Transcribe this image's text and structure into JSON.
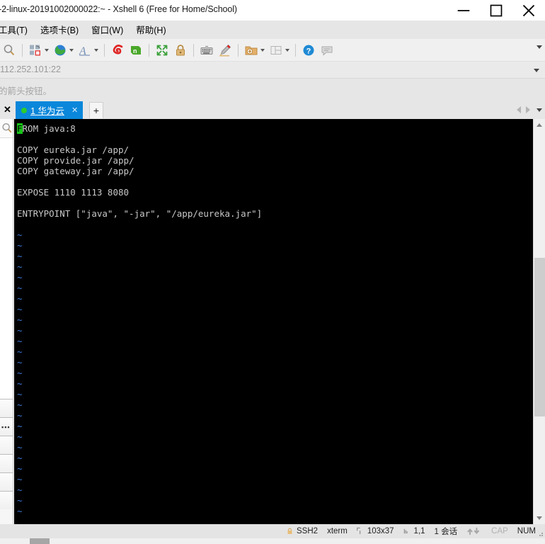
{
  "window": {
    "title": "-2-linux-20191002000022:~ - Xshell 6 (Free for Home/School)",
    "minimize_label": "minimize",
    "maximize_label": "maximize",
    "close_label": "close"
  },
  "menu": {
    "items": [
      {
        "label": "工具(T)",
        "name": "menu-tools"
      },
      {
        "label": "选项卡(B)",
        "name": "menu-tabs"
      },
      {
        "label": "窗口(W)",
        "name": "menu-window"
      },
      {
        "label": "帮助(H)",
        "name": "menu-help"
      }
    ]
  },
  "toolbar": {
    "buttons": [
      {
        "name": "find-icon",
        "icon": "magnifier"
      },
      {
        "name": "session-manager-icon",
        "icon": "session",
        "caret": true
      },
      {
        "name": "globe-icon",
        "icon": "globe",
        "caret": true
      },
      {
        "name": "font-icon",
        "icon": "font-a",
        "caret": true
      },
      {
        "name": "xftp-icon",
        "icon": "xftp-spiral"
      },
      {
        "name": "xagent-icon",
        "icon": "green-n"
      },
      {
        "name": "fullscreen-icon",
        "icon": "expand"
      },
      {
        "name": "lock-icon",
        "icon": "padlock"
      },
      {
        "name": "keyboard-icon",
        "icon": "keyboard"
      },
      {
        "name": "highlight-icon",
        "icon": "pencil"
      },
      {
        "name": "new-folder-icon",
        "icon": "folder-plus",
        "caret": true
      },
      {
        "name": "layout-icon",
        "icon": "layout",
        "caret": true
      },
      {
        "name": "help-icon",
        "icon": "question-circle"
      },
      {
        "name": "chat-icon",
        "icon": "speech-bubble"
      }
    ],
    "overflow_label": "more"
  },
  "address": {
    "value": "112.252.101:22",
    "placeholder": "112.252.101:22"
  },
  "hint": {
    "text": "的箭头按钮。"
  },
  "tabs": {
    "close_all_label": "✕",
    "items": [
      {
        "label": "1 华为云",
        "close": "✕",
        "active": true
      }
    ],
    "new_tab_label": "+",
    "nav_prev_label": "prev",
    "nav_next_label": "next"
  },
  "terminal": {
    "lines": [
      {
        "text": "FROM java:8",
        "cursor_at": 0
      },
      {
        "text": ""
      },
      {
        "text": "COPY eureka.jar /app/"
      },
      {
        "text": "COPY provide.jar /app/"
      },
      {
        "text": "COPY gateway.jar /app/"
      },
      {
        "text": ""
      },
      {
        "text": "EXPOSE 1110 1113 8080"
      },
      {
        "text": ""
      },
      {
        "text": "ENTRYPOINT [\"java\", \"-jar\", \"/app/eureka.jar\"]"
      },
      {
        "text": ""
      }
    ],
    "tilde_count": 27,
    "tilde_char": "~",
    "bg_color": "#000000",
    "fg_color": "#c8c8c8",
    "tilde_color": "#3b78d8",
    "cursor_color": "#16c216"
  },
  "statusbar": {
    "protocol": "SSH2",
    "terminal_type": "xterm",
    "size": "103x37",
    "cursor_pos": "1,1",
    "sessions": "1 会话",
    "cap": "CAP",
    "num": "NUM"
  }
}
